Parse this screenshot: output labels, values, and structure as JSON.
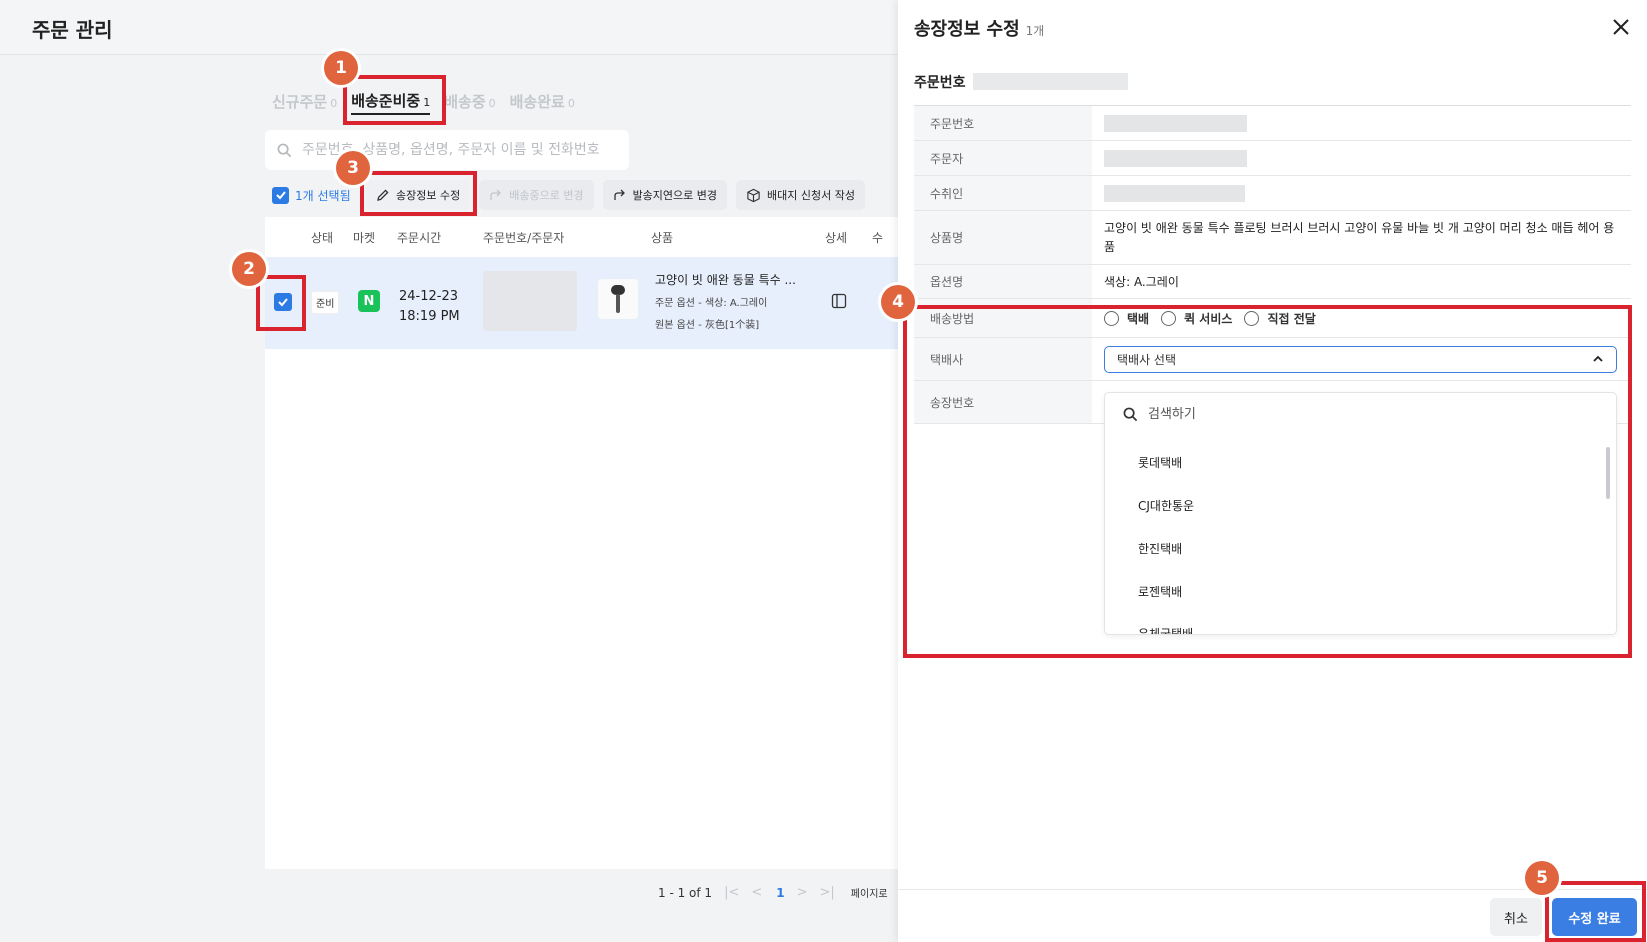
{
  "page": {
    "title": "주문 관리"
  },
  "tabs": [
    {
      "label": "신규주문",
      "count": "0",
      "active": false
    },
    {
      "label": "배송준비중",
      "count": "1",
      "active": true
    },
    {
      "label": "배송중",
      "count": "0",
      "active": false
    },
    {
      "label": "배송완료",
      "count": "0",
      "active": false
    }
  ],
  "search": {
    "placeholder": "주문번호, 상품명, 옵션명, 주문자 이름 및 전화번호"
  },
  "toolbar": {
    "selected_label": "1개 선택됨",
    "edit_invoice": "송장정보 수정",
    "to_shipping": "배송중으로 변경",
    "delay": "발송지연으로 변경",
    "waybill": "배대지 신청서 작성"
  },
  "table": {
    "headers": [
      "상태",
      "마켓",
      "주문시간",
      "주문번호/주문자",
      "상품",
      "상세",
      "수"
    ],
    "row": {
      "status": "준비",
      "market": "N",
      "date": "24-12-23",
      "time": "18:19 PM",
      "product_name": "고양이 빗 애완 동물 특수 ...",
      "option": "주문 옵션 - 색상: A.그레이",
      "original_option": "원본 옵션 - 灰色[1个装]"
    }
  },
  "pagination": {
    "range": "1 - 1 of 1",
    "current": "1",
    "page_label": "페이지로"
  },
  "drawer": {
    "title": "송장정보 수정",
    "subtitle": "1개",
    "order_header": "주문번호",
    "rows": {
      "order_no": "주문번호",
      "orderer": "주문자",
      "recipient": "수취인",
      "product": "상품명",
      "product_value": "고양이 빗 애완 동물 특수 플로팅 브러시 브러시 고양이 유물 바늘 빗 개 고양이 머리 청소 매듭 헤어 용품",
      "option": "옵션명",
      "option_value": "색상: A.그레이",
      "shipping_method": "배송방법",
      "courier": "택배사",
      "invoice": "송장번호"
    },
    "shipping_methods": [
      "택배",
      "퀵 서비스",
      "직접 전달"
    ],
    "courier_placeholder": "택배사 선택",
    "dropdown": {
      "search_placeholder": "검색하기",
      "items": [
        "롯데택배",
        "CJ대한통운",
        "한진택배",
        "로젠택배",
        "우체국택배"
      ]
    },
    "cancel": "취소",
    "submit": "수정 완료"
  },
  "annotations": [
    "1",
    "2",
    "3",
    "4",
    "5"
  ],
  "colors": {
    "accent": "#3a7de3",
    "highlight": "#d9232e",
    "marker": "#e0643d",
    "naver": "#19c35a"
  }
}
